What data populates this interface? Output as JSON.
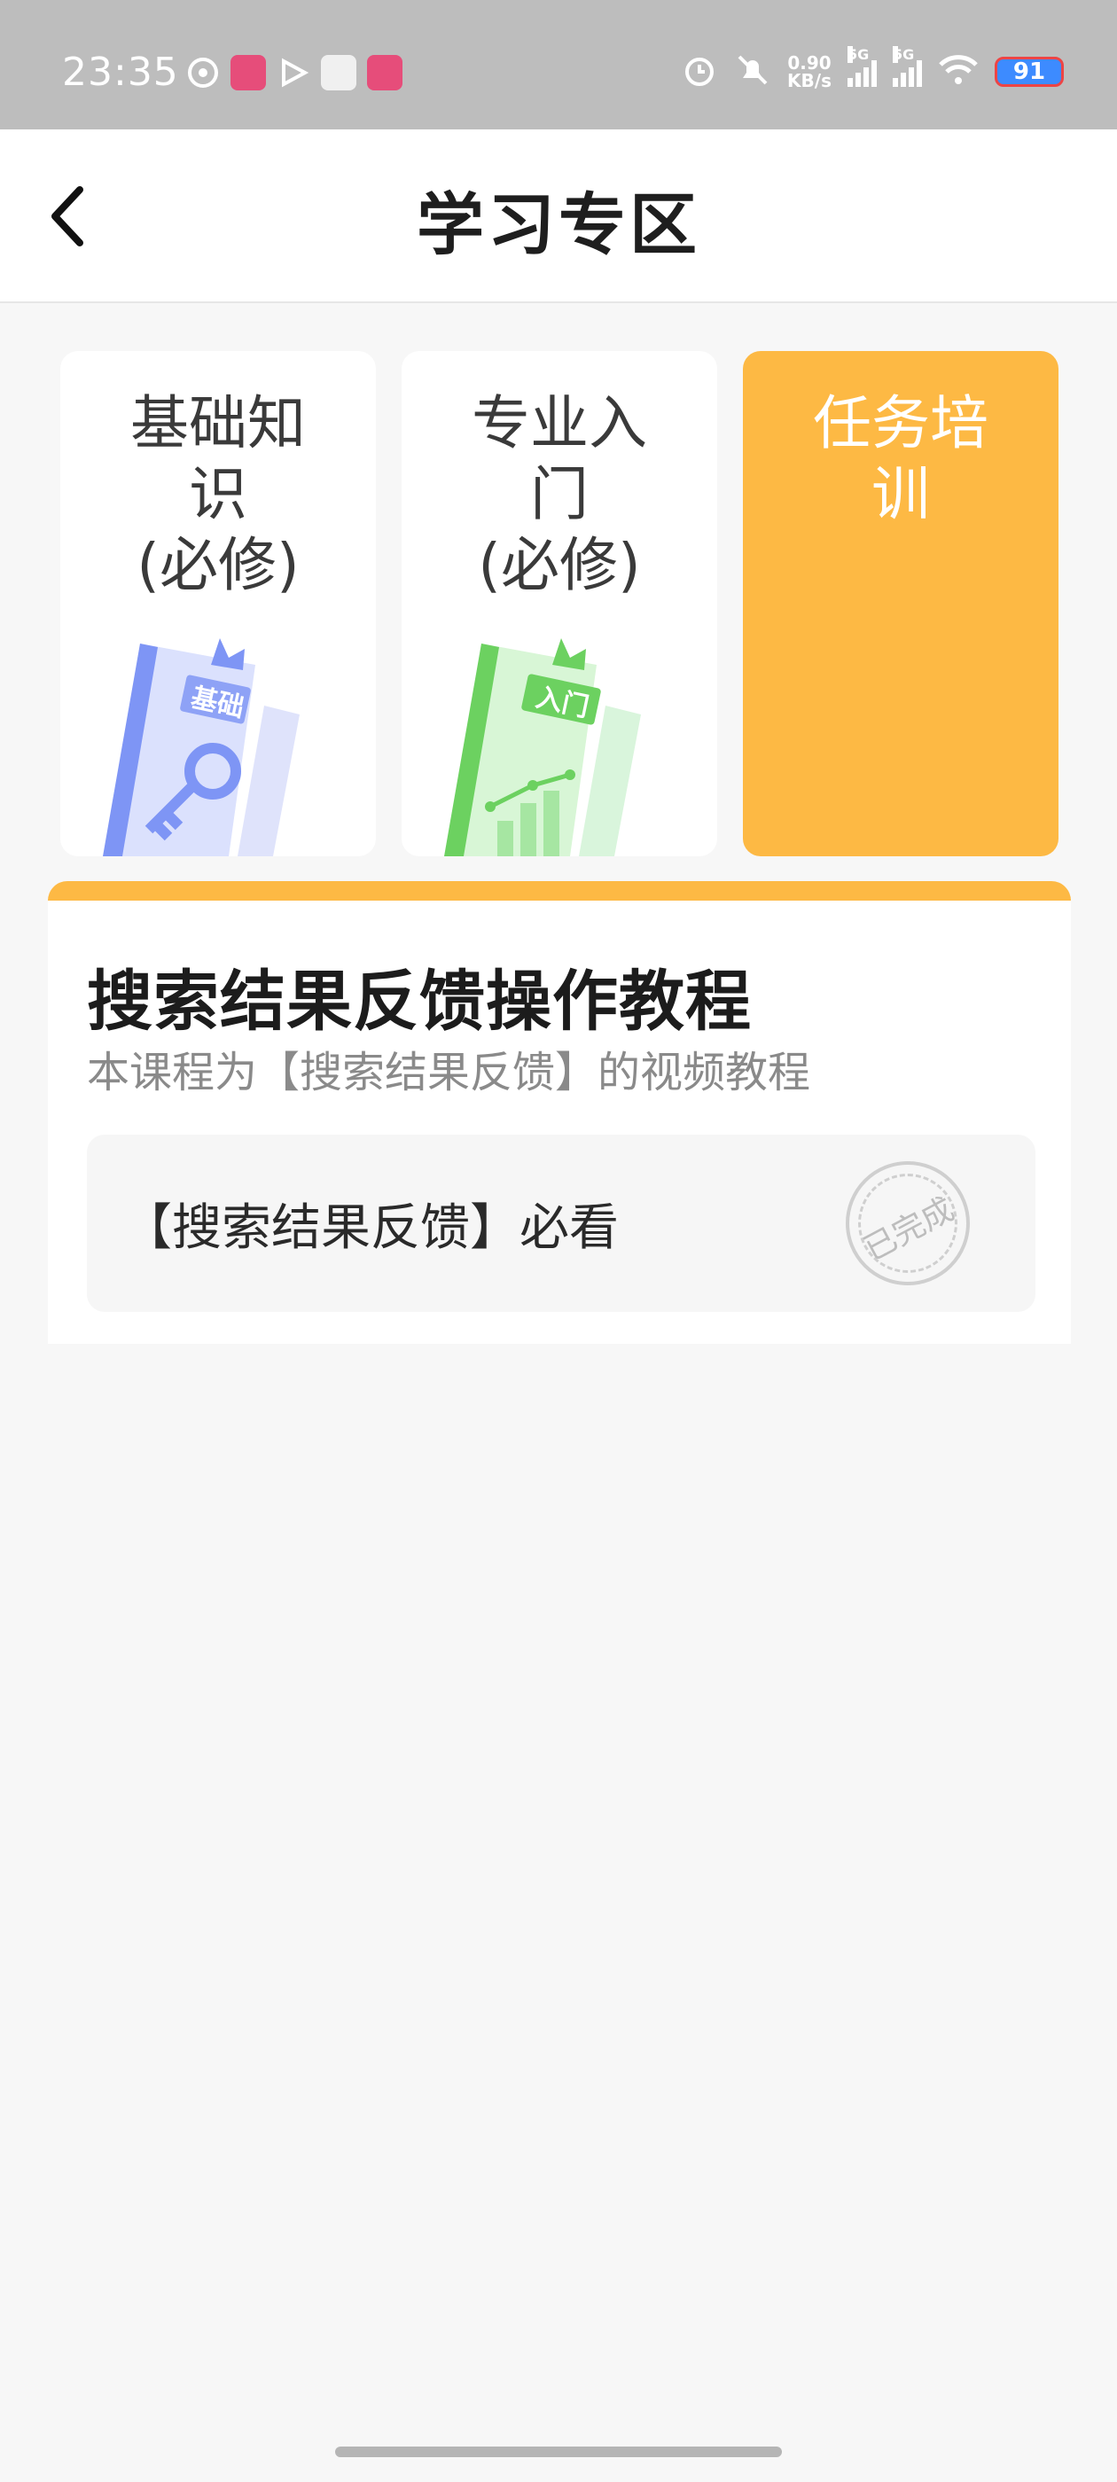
{
  "status_bar": {
    "time": "23:35",
    "net_speed_value": "0.90",
    "net_speed_unit": "KB/s",
    "signal1_tag": "5G",
    "signal2_tag": "5G",
    "battery": "91"
  },
  "header": {
    "title": "学习专区"
  },
  "categories": [
    {
      "label": "基础知\n识\n(必修)",
      "badge": "基础",
      "active": false
    },
    {
      "label": "专业入\n门\n(必修)",
      "badge": "入门",
      "active": false
    },
    {
      "label": "任务培\n训",
      "active": true
    }
  ],
  "course": {
    "title": "搜索结果反馈操作教程",
    "description": "本课程为【搜索结果反馈】的视频教程",
    "lesson": {
      "title": "【搜索结果反馈】必看",
      "status": "已完成"
    }
  },
  "colors": {
    "accent": "#fdb944",
    "status_bar": "#bdbdbd",
    "background": "#f7f7f7"
  }
}
